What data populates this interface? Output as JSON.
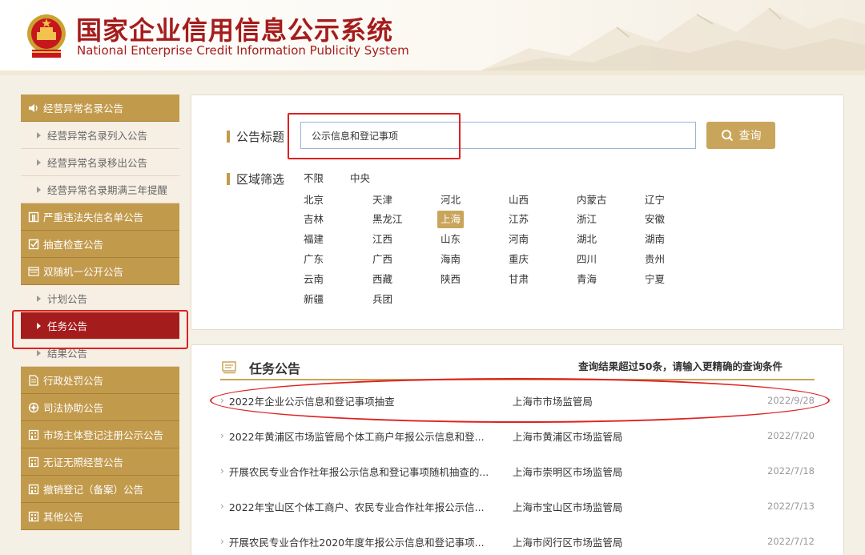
{
  "header": {
    "title_cn": "国家企业信用信息公示系统",
    "title_en": "National Enterprise Credit Information Publicity System"
  },
  "sidebar": {
    "items": [
      {
        "label": "经营异常名录公告",
        "type": "cat",
        "icon": "speaker-icon"
      },
      {
        "label": "经营异常名录列入公告",
        "type": "sub"
      },
      {
        "label": "经营异常名录移出公告",
        "type": "sub"
      },
      {
        "label": "经营异常名录期满三年提醒",
        "type": "sub"
      },
      {
        "label": "严重违法失信名单公告",
        "type": "cat",
        "icon": "banner-icon"
      },
      {
        "label": "抽查检查公告",
        "type": "cat",
        "icon": "checkbox-icon"
      },
      {
        "label": "双随机一公开公告",
        "type": "cat",
        "icon": "window-icon"
      },
      {
        "label": "计划公告",
        "type": "sub"
      },
      {
        "label": "任务公告",
        "type": "sub",
        "active": true
      },
      {
        "label": "结果公告",
        "type": "sub"
      },
      {
        "label": "行政处罚公告",
        "type": "cat",
        "icon": "document-icon"
      },
      {
        "label": "司法协助公告",
        "type": "cat",
        "icon": "gear-icon"
      },
      {
        "label": "市场主体登记注册公示公告",
        "type": "cat",
        "icon": "building-icon"
      },
      {
        "label": "无证无照经营公告",
        "type": "cat",
        "icon": "building-icon"
      },
      {
        "label": "撤销登记（备案）公告",
        "type": "cat",
        "icon": "building-icon"
      },
      {
        "label": "其他公告",
        "type": "cat",
        "icon": "building-icon"
      }
    ]
  },
  "search": {
    "title_label": "公告标题",
    "input_value": "公示信息和登记事项",
    "button_label": "查询",
    "region_label": "区域筛选",
    "regions_top": [
      "不限",
      "中央"
    ],
    "regions": [
      "北京",
      "天津",
      "河北",
      "山西",
      "内蒙古",
      "辽宁",
      "吉林",
      "黑龙江",
      "上海",
      "江苏",
      "浙江",
      "安徽",
      "福建",
      "江西",
      "山东",
      "河南",
      "湖北",
      "湖南",
      "广东",
      "广西",
      "海南",
      "重庆",
      "四川",
      "贵州",
      "云南",
      "西藏",
      "陕西",
      "甘肃",
      "青海",
      "宁夏",
      "新疆",
      "兵团"
    ],
    "selected_region": "上海"
  },
  "results": {
    "title": "任务公告",
    "hint": "查询结果超过50条，请输入更精确的查询条件",
    "rows": [
      {
        "title": "2022年企业公示信息和登记事项抽查",
        "org": "上海市市场监管局",
        "date": "2022/9/28"
      },
      {
        "title": "2022年黄浦区市场监管局个体工商户年报公示信息和登...",
        "org": "上海市黄浦区市场监管局",
        "date": "2022/7/20"
      },
      {
        "title": "开展农民专业合作社年报公示信息和登记事项随机抽查的...",
        "org": "上海市崇明区市场监管局",
        "date": "2022/7/18"
      },
      {
        "title": "2022年宝山区个体工商户、农民专业合作社年报公示信...",
        "org": "上海市宝山区市场监管局",
        "date": "2022/7/13"
      },
      {
        "title": "开展农民专业合作社2020年度年报公示信息和登记事项...",
        "org": "上海市闵行区市场监管局",
        "date": "2022/7/12"
      }
    ]
  },
  "colors": {
    "brand_red": "#a51c1c",
    "gold": "#c29a4c",
    "highlight": "#e02020"
  }
}
